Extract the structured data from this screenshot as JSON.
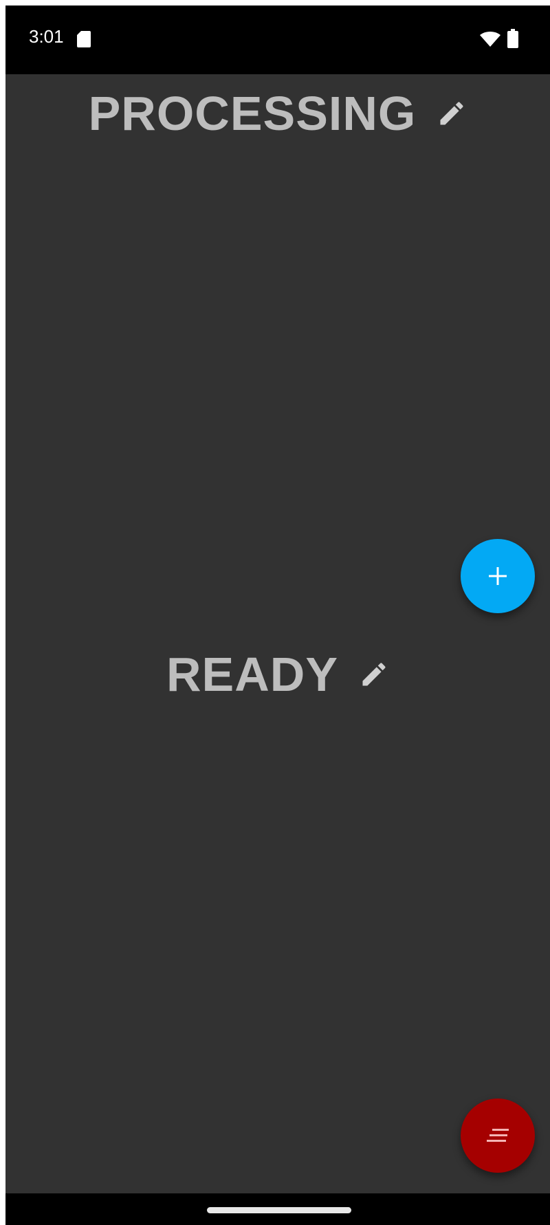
{
  "status_bar": {
    "time": "3:01",
    "icons": [
      "sd-card-icon",
      "wifi-icon",
      "battery-icon"
    ]
  },
  "sections": [
    {
      "title": "PROCESSING",
      "edit_icon": "pencil-icon"
    },
    {
      "title": "READY",
      "edit_icon": "pencil-icon"
    }
  ],
  "fabs": {
    "add": {
      "icon": "plus-icon",
      "color": "#03a9f4"
    },
    "menu": {
      "icon": "lines-icon",
      "color": "#a50000"
    }
  },
  "colors": {
    "background": "#323232",
    "title_text": "#bdbdbd",
    "status_bar": "#000000"
  }
}
